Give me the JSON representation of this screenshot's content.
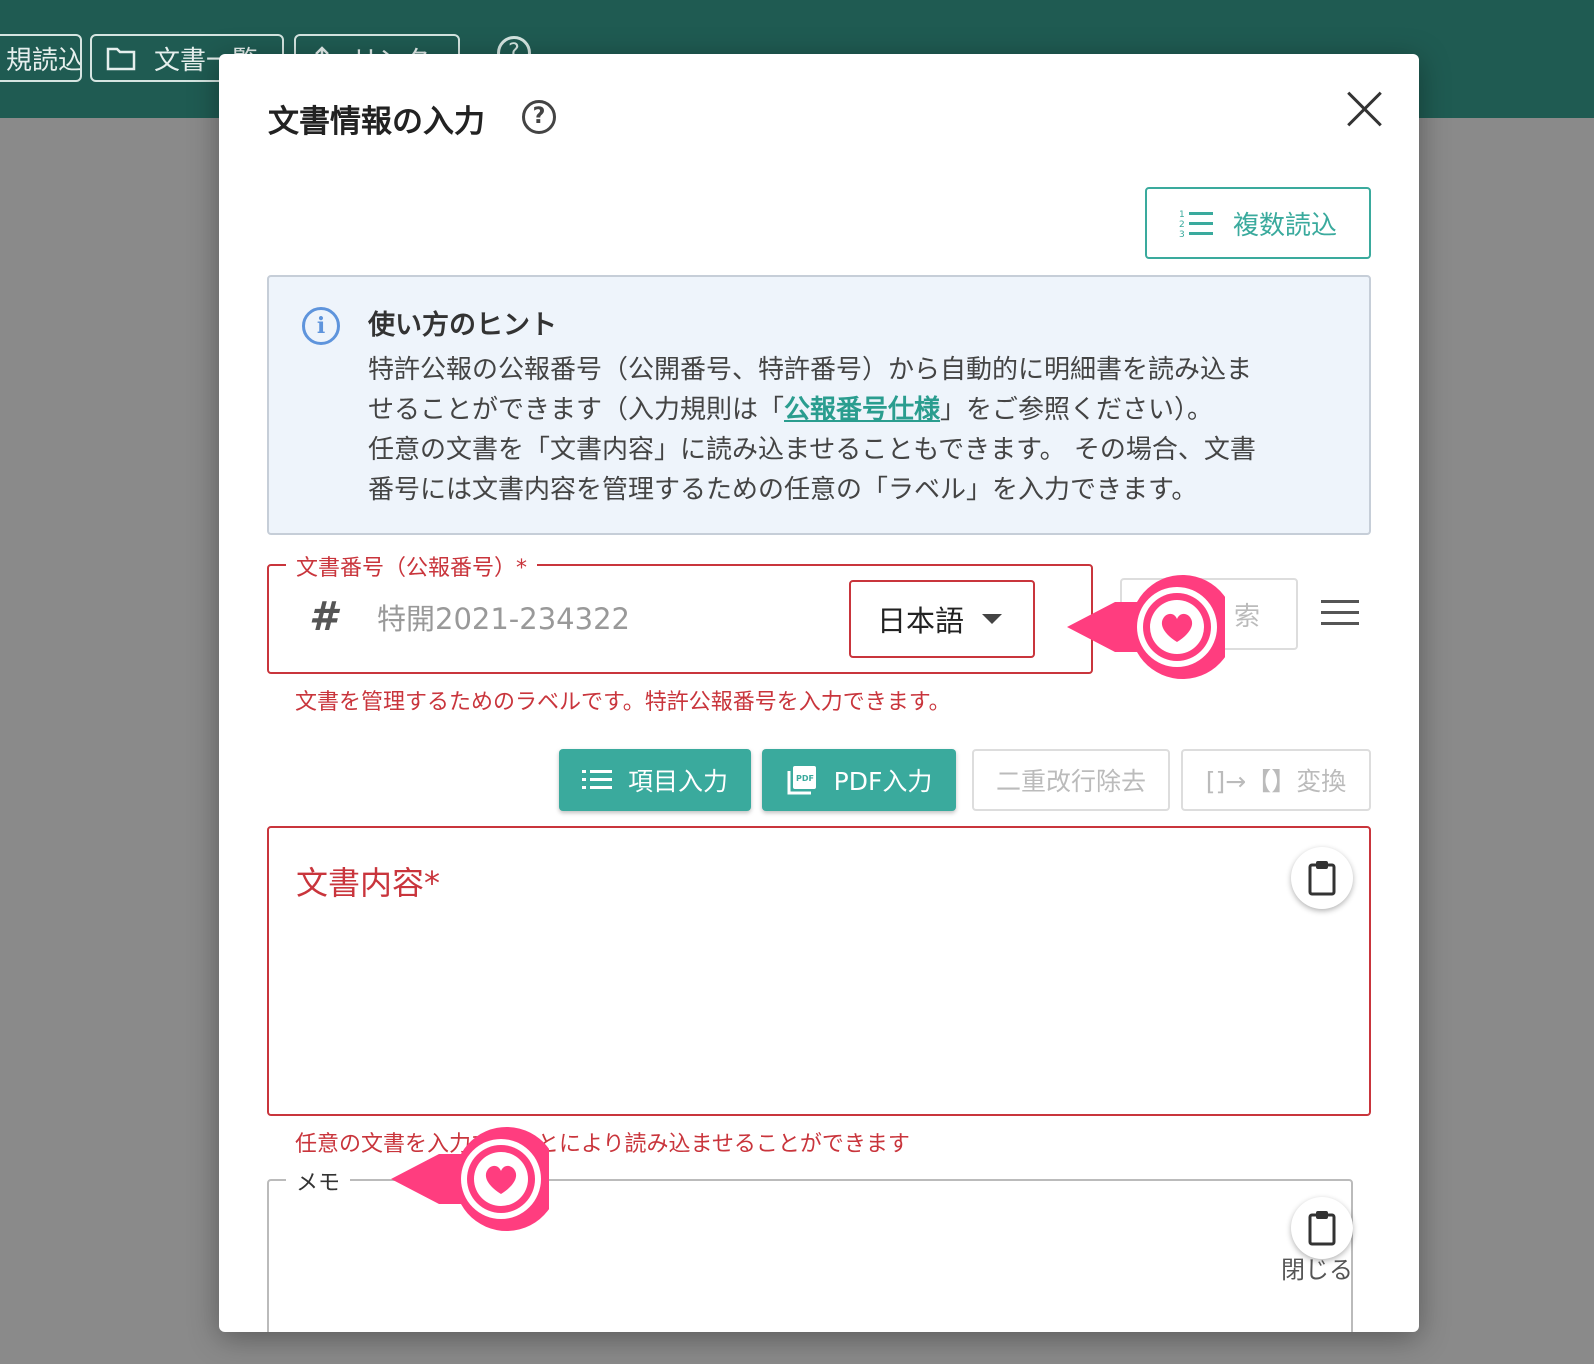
{
  "background": {
    "toolbar_buttons": [
      {
        "label": "規読込"
      },
      {
        "label": "文書一覧"
      },
      {
        "label": "リンク"
      }
    ],
    "help_glyph": "?"
  },
  "dialog": {
    "title": "文書情報の入力",
    "help_glyph": "?",
    "multi_load_label": "複数読込",
    "hint": {
      "title": "使い方のヒント",
      "line1": "特許公報の公報番号（公開番号、特許番号）から自動的に明細書を読み込ま",
      "line2_pre": "せることができます（入力規則は「",
      "line2_link": "公報番号仕様",
      "line2_post": "」をご参照ください）。",
      "line3": "任意の文書を「文書内容」に読み込ませることもできます。 その場合、文書",
      "line4": "番号には文書内容を管理するための任意の「ラベル」を入力できます。"
    },
    "doc_number": {
      "legend": "文書番号（公報番号）*",
      "hash": "#",
      "placeholder": "特開2021-234322",
      "value": "",
      "language": "日本語",
      "helper": "文書を管理するためのラベルです。特許公報番号を入力できます。"
    },
    "search_label": "索",
    "toolbar": {
      "item_input": "項目入力",
      "pdf_input": "PDF入力",
      "remove_double_newline": "二重改行除去",
      "bracket_convert": "[]→【】変換"
    },
    "content": {
      "label": "文書内容*",
      "helper": "任意の文書を入力することにより読み込ませることができます"
    },
    "memo": {
      "legend": "メモ"
    },
    "close_label": "閉じる"
  },
  "colors": {
    "accent": "#3aaa9d",
    "error": "#c9353c",
    "app_bar": "#1f5b52",
    "marker": "#ff3d7f"
  }
}
